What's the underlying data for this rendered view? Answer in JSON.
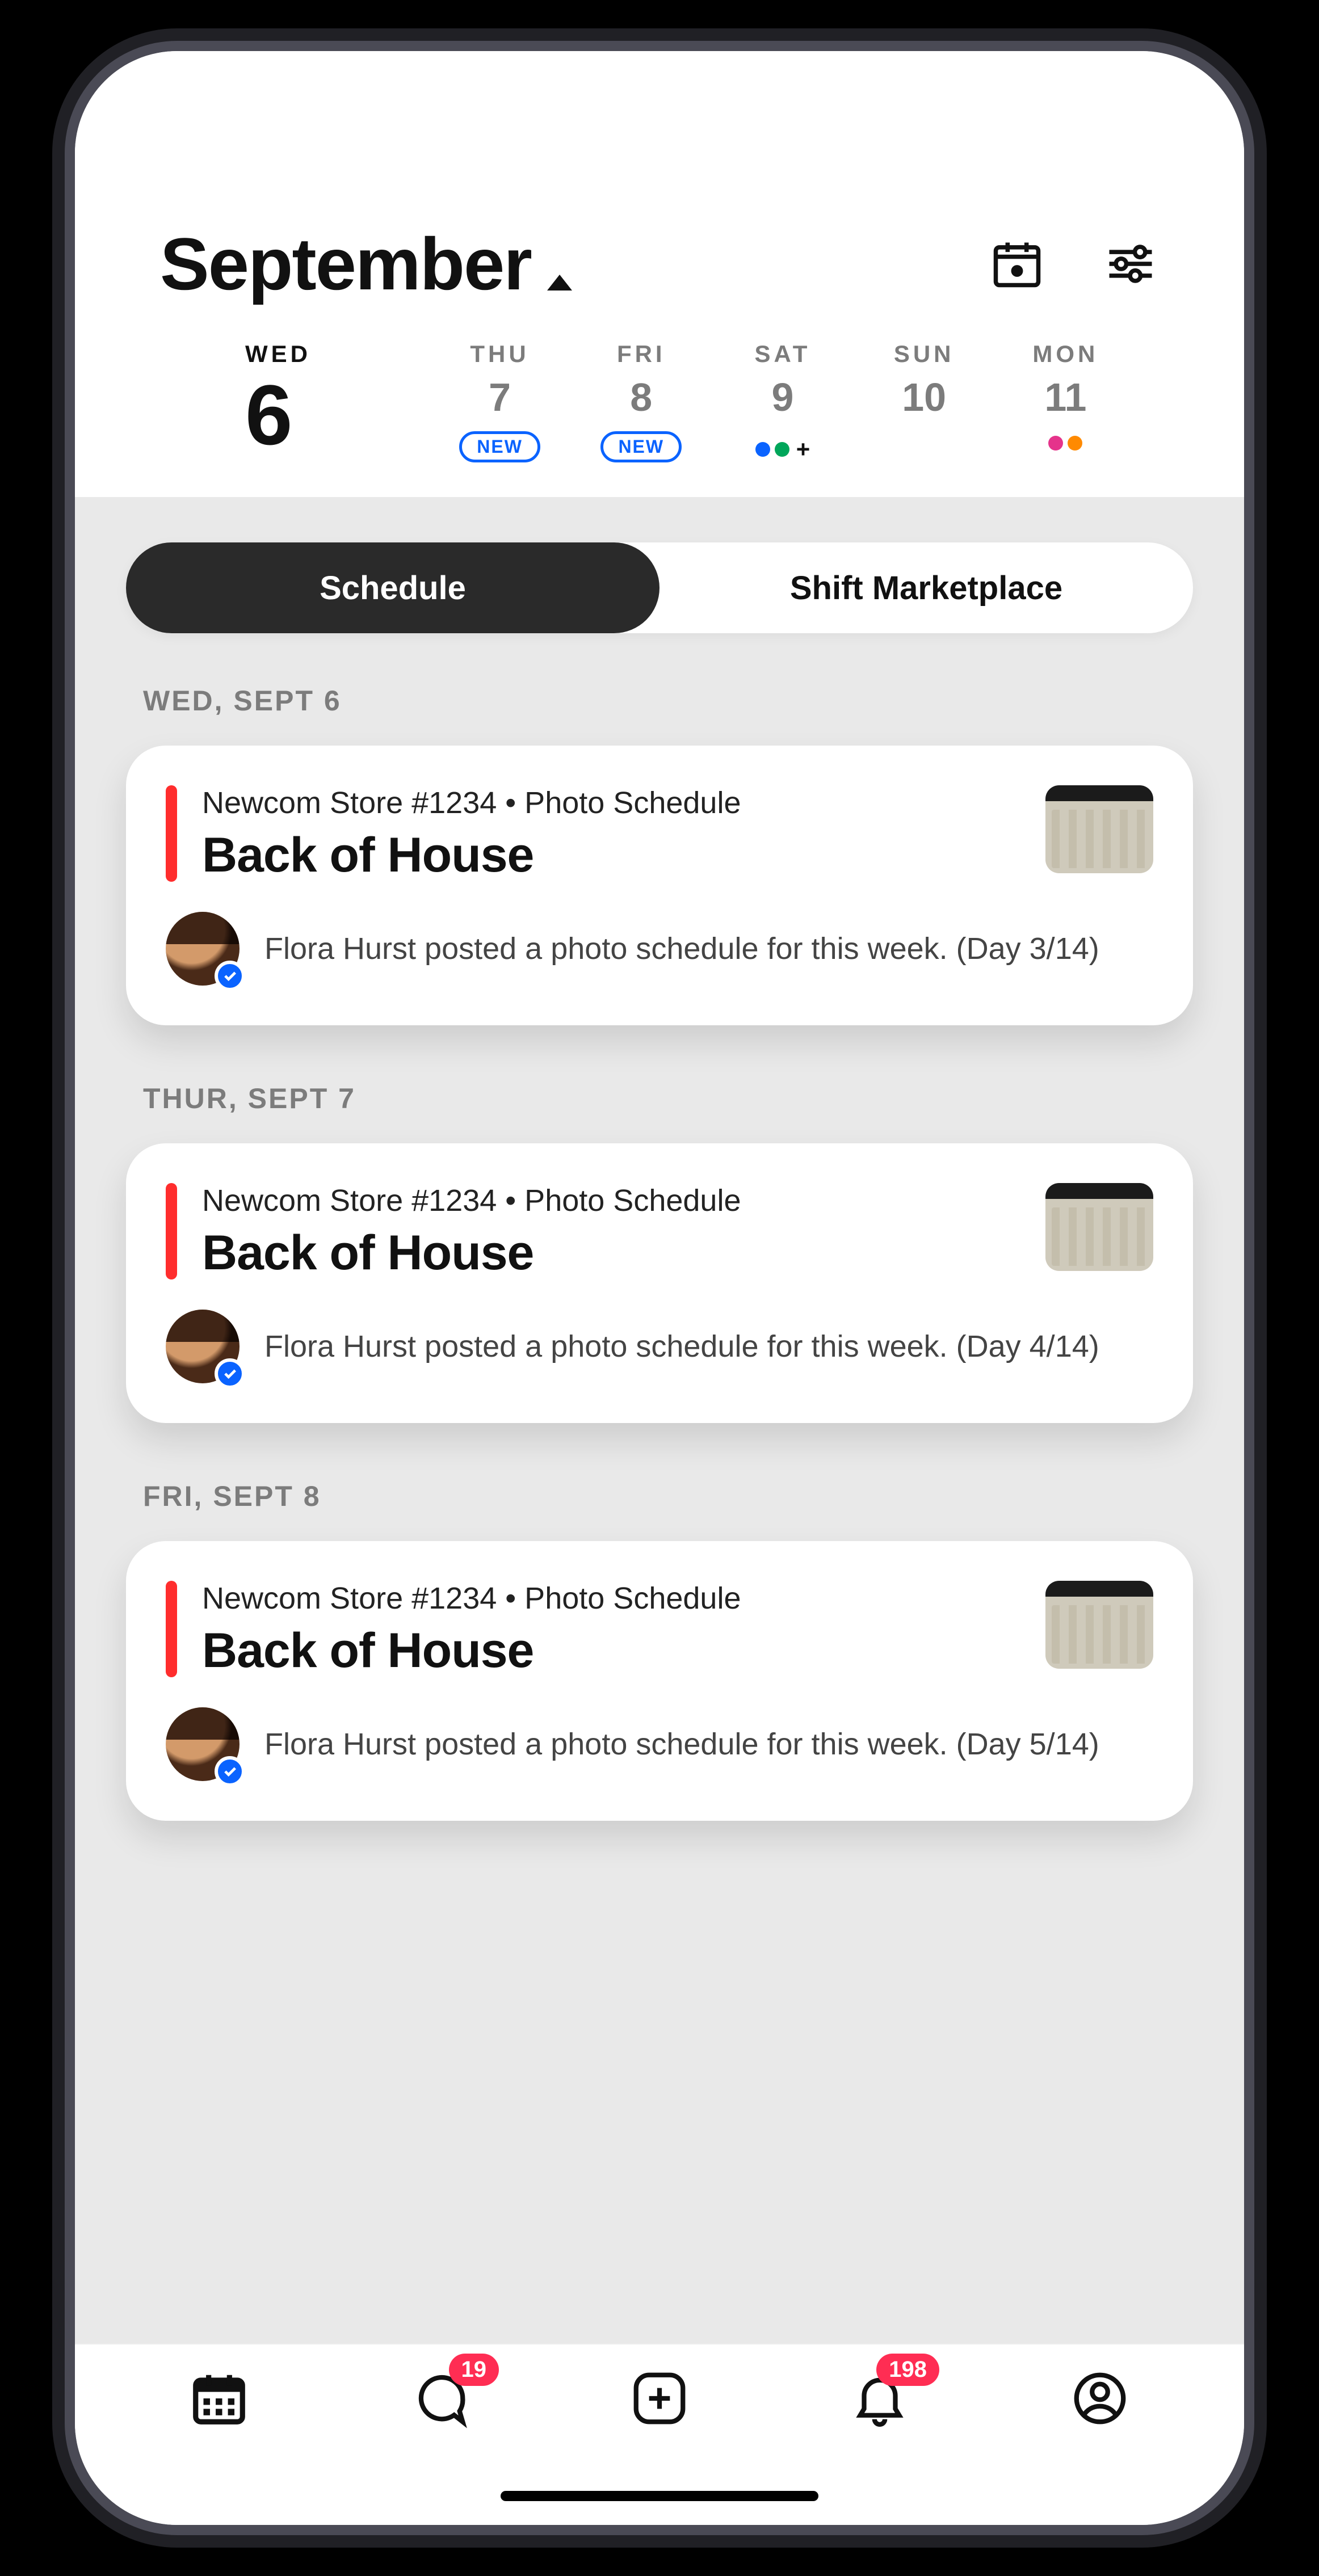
{
  "header": {
    "month": "September"
  },
  "days": [
    {
      "dow": "WED",
      "num": "6",
      "selected": true
    },
    {
      "dow": "THU",
      "num": "7",
      "new_label": "NEW"
    },
    {
      "dow": "FRI",
      "num": "8",
      "new_label": "NEW"
    },
    {
      "dow": "SAT",
      "num": "9",
      "dots": [
        "blue",
        "green"
      ],
      "plus": "+"
    },
    {
      "dow": "SUN",
      "num": "10"
    },
    {
      "dow": "MON",
      "num": "11",
      "dots": [
        "pink",
        "orange"
      ]
    }
  ],
  "tabs": {
    "schedule": "Schedule",
    "marketplace": "Shift Marketplace"
  },
  "groups": [
    {
      "label": "WED, SEPT 6",
      "card": {
        "subtitle": "Newcom Store #1234 • Photo Schedule",
        "title": "Back of House",
        "post": "Flora Hurst posted a photo schedule for this week. (Day 3/14)"
      }
    },
    {
      "label": "THUR, SEPT 7",
      "card": {
        "subtitle": "Newcom Store #1234 • Photo Schedule",
        "title": "Back of House",
        "post": "Flora Hurst posted a photo schedule for this week. (Day 4/14)"
      }
    },
    {
      "label": "FRI, SEPT 8",
      "card": {
        "subtitle": "Newcom Store #1234 • Photo Schedule",
        "title": "Back of House",
        "post": "Flora Hurst posted a photo schedule for this week. (Day 5/14)"
      }
    }
  ],
  "nav_badges": {
    "chat": "19",
    "alerts": "198"
  }
}
